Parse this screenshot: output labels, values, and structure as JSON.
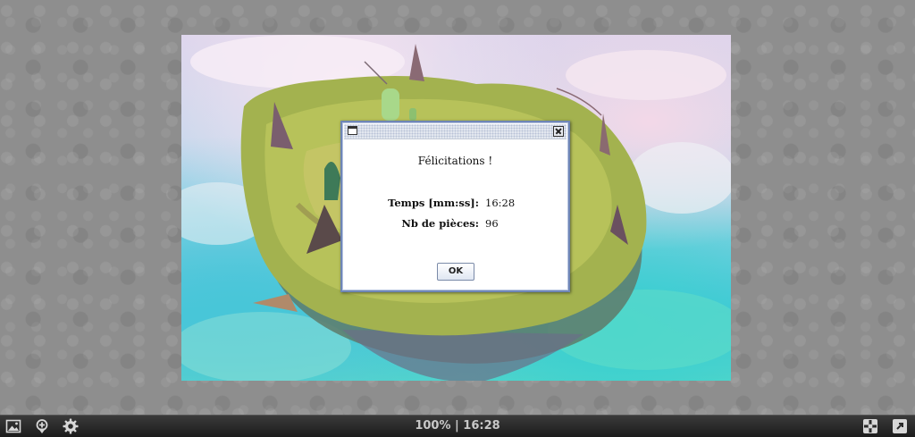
{
  "dialog": {
    "message": "Félicitations !",
    "time_label": "Temps [mm:ss]:",
    "time_value": "16:28",
    "pieces_label": "Nb de pièces:",
    "pieces_value": "96",
    "ok_label": "OK"
  },
  "toolbar": {
    "status": "100% | 16:28",
    "icons": [
      "image-icon",
      "pin-icon",
      "gear-icon",
      "puzzle-piece-icon",
      "fullscreen-icon"
    ]
  },
  "colors": {
    "dialog_border": "#6f86b6",
    "toolbar_bg": "#2a2a2a",
    "background": "#8e8e8e"
  }
}
